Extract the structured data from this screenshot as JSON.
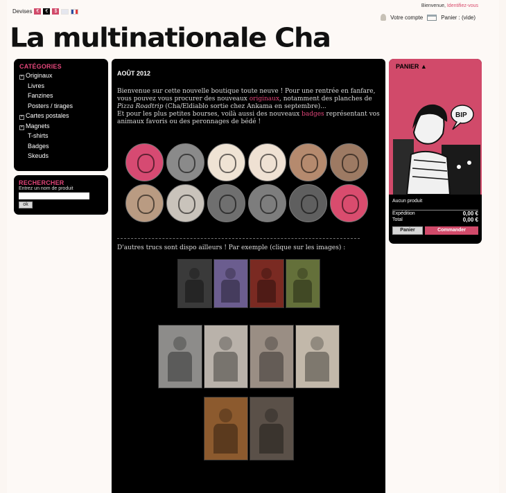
{
  "top": {
    "devises_label": "Devises",
    "currencies": [
      "€",
      "€",
      "$"
    ],
    "welcome_text": "Bienvenue,",
    "login_link": "Identifiez-vous",
    "account_link": "Votre compte",
    "cart_link": "Panier : (vide)"
  },
  "logo": "La multinationale Cha",
  "categories": {
    "title": "CATÉGORIES",
    "items": [
      {
        "label": "Originaux",
        "expandable": true
      },
      {
        "label": "Livres",
        "expandable": false
      },
      {
        "label": "Fanzines",
        "expandable": false
      },
      {
        "label": "Posters / tirages",
        "expandable": false
      },
      {
        "label": "Cartes postales",
        "expandable": true
      },
      {
        "label": "Magnets",
        "expandable": true
      },
      {
        "label": "T-shirts",
        "expandable": false
      },
      {
        "label": "Badges",
        "expandable": false
      },
      {
        "label": "Skeuds",
        "expandable": false
      }
    ]
  },
  "search": {
    "title": "RECHERCHER",
    "hint": "Entrez un nom de produit",
    "button": "ok"
  },
  "main": {
    "date": "AOÛT 2012",
    "intro_1": "Bienvenue sur cette nouvelle boutique toute neuve ! Pour une rentrée en fanfare, vous pouvez vous procurer des nouveaux ",
    "intro_link_1": "originaux",
    "intro_2": ", notamment des planches de ",
    "intro_italic": "Pizza Roadtrip",
    "intro_3": " (Cha/Eldiablo sortie chez Ankama en septembre)...",
    "intro_4": "Et pour les plus petites bourses, voilà aussi des nouveaux ",
    "intro_link_2": "badges",
    "intro_5": " représentant vos animaux favoris ou des peronnages de bédé !",
    "more_text": "D'autres trucs sont dispo ailleurs ! Par exemple (clique sur les images) :"
  },
  "cart": {
    "title": "PANIER",
    "empty": "Aucun produit",
    "shipping_label": "Expédition",
    "shipping_value": "0,00 €",
    "total_label": "Total",
    "total_value": "0,00 €",
    "panier_button": "Panier",
    "commander_button": "Commander",
    "bubble_text": "BIP"
  },
  "colors": {
    "accent": "#e2467a",
    "cart_pink": "#d14a6a"
  }
}
